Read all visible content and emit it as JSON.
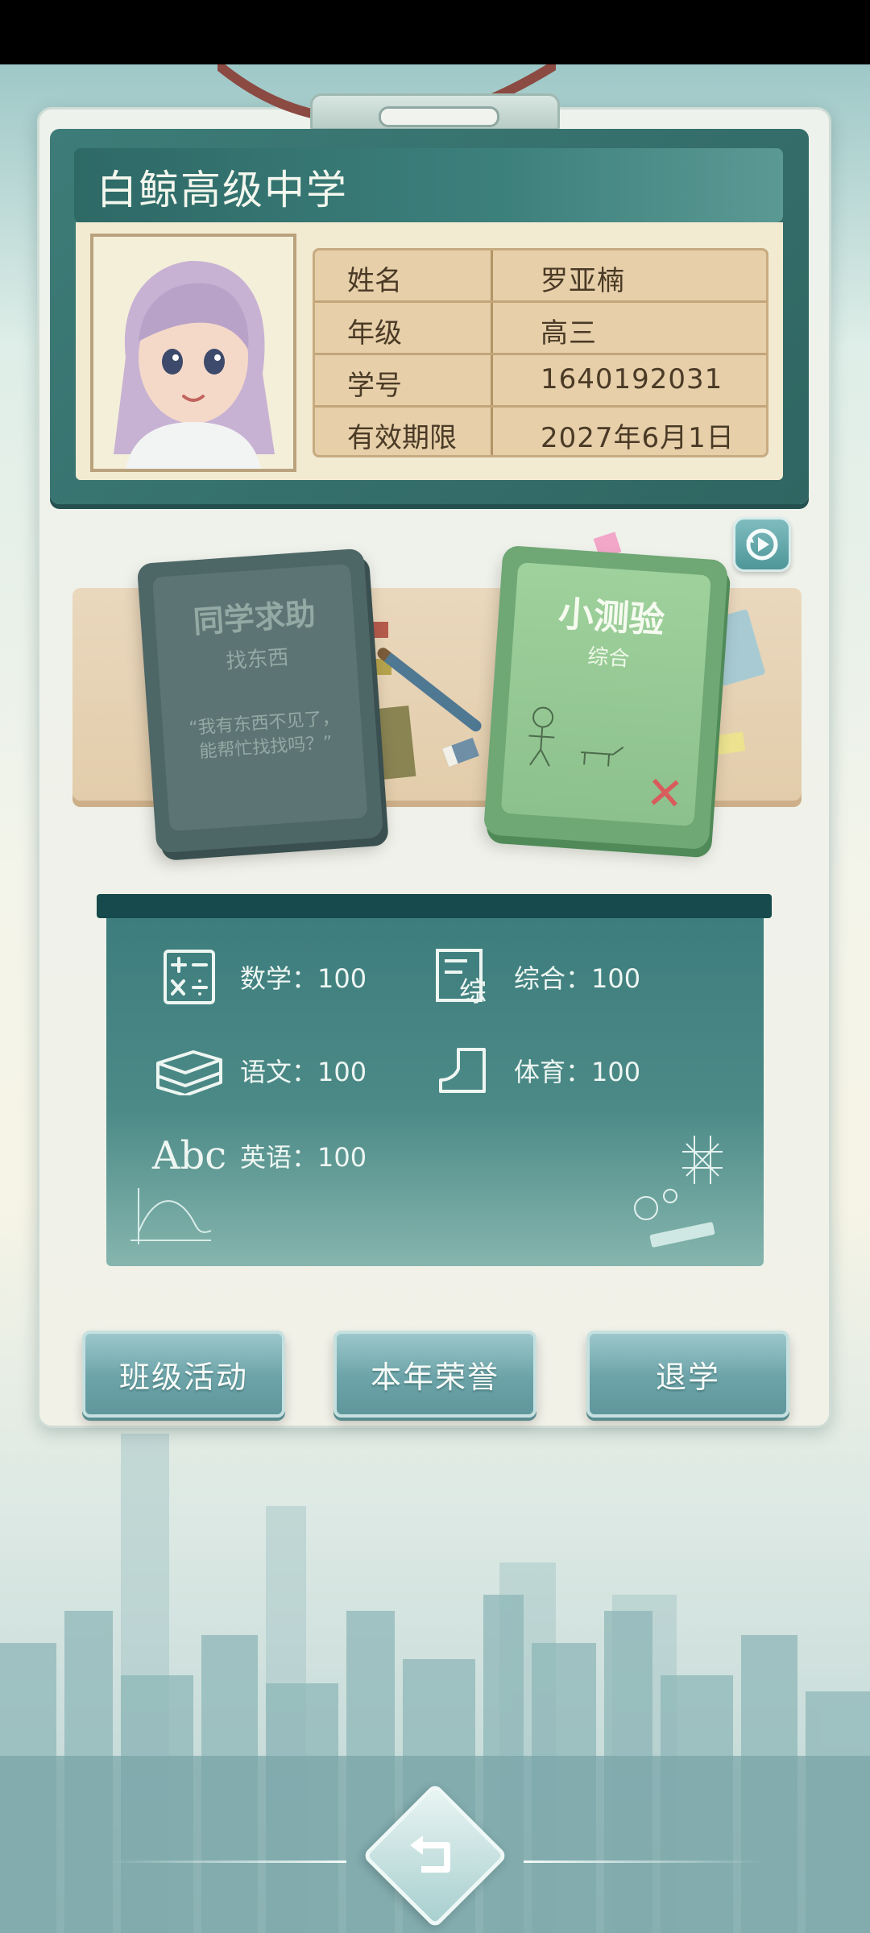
{
  "id_card": {
    "school_name": "白鲸高级中学",
    "rows": [
      {
        "label": "姓名",
        "value": "罗亚楠"
      },
      {
        "label": "年级",
        "value": "高三"
      },
      {
        "label": "学号",
        "value": "1640192031"
      },
      {
        "label": "有效期限",
        "value": "2027年6月1日"
      }
    ]
  },
  "help_card": {
    "title": "同学求助",
    "subtitle": "找东西",
    "quote": "“我有东西不见了，能帮忙找找吗？”"
  },
  "quiz_card": {
    "title": "小测验",
    "subtitle": "综合"
  },
  "grades": {
    "math": "数学：100",
    "general": "综合：100",
    "chinese": "语文：100",
    "pe": "体育：100",
    "english": "英语：100",
    "english_icon_text": "Abc",
    "general_icon_text": "综"
  },
  "buttons": {
    "class_activity": "班级活动",
    "annual_honor": "本年荣誉",
    "drop_out": "退学"
  },
  "icons": {
    "replay": "replay-icon",
    "back": "back-arrow-icon"
  },
  "colors": {
    "panel": "#3d7c78",
    "board": "#3d7d7d",
    "button": "#6ba3a8"
  }
}
